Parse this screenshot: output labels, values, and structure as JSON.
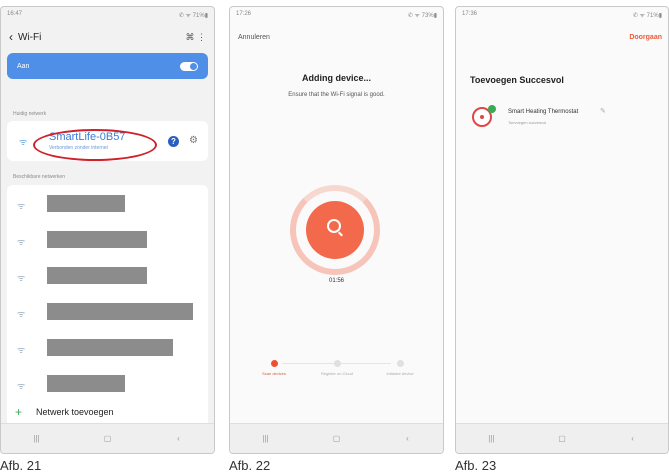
{
  "colors": {
    "accent": "#f26a4b",
    "blue": "#4f8fe8",
    "highlight": "#d0202a"
  },
  "phone1": {
    "status_time": "16:47",
    "status_right": "✆ ᯤ 71%▮",
    "title": "Wi-Fi",
    "header_icons": "⌘  ⋮",
    "on_label": "Aan",
    "current_section": "Huidig netwerk",
    "ssid": "SmartLife-0B57",
    "ssid_sub": "Verbonden zonder internet",
    "available_section": "Beschikbare netwerken",
    "add_network": "Netwerk toevoegen",
    "nav": [
      "|||",
      "▢",
      "‹"
    ],
    "caption": "Afb. 21"
  },
  "phone2": {
    "status_time": "17:26",
    "status_right": "✆ ᯤ 73%▮",
    "cancel": "Annuleren",
    "title": "Adding device...",
    "subtitle": "Ensure that the Wi-Fi signal is good.",
    "timer": "01:56",
    "steps": [
      "Scan devices",
      "Register on Cloud",
      "Initialize device"
    ],
    "nav": [
      "|||",
      "▢",
      "‹"
    ],
    "caption": "Afb. 22"
  },
  "phone3": {
    "status_time": "17:36",
    "status_right": "✆ ᯤ 71%▮",
    "continue": "Doorgaan",
    "title": "Toevoegen Succesvol",
    "device_name": "Smart Heating Thermostat",
    "device_sub": "Toevoegen succesvol",
    "nav": [
      "|||",
      "▢",
      "‹"
    ],
    "caption": "Afb. 23"
  }
}
